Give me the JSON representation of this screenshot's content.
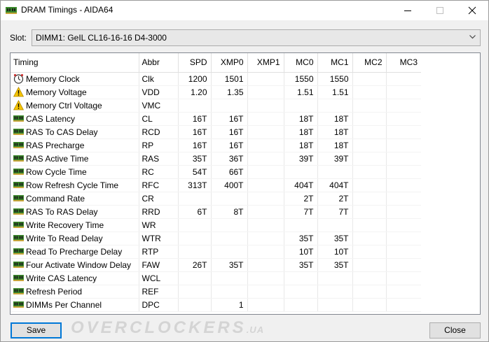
{
  "window": {
    "title": "DRAM Timings - AIDA64"
  },
  "slot": {
    "label": "Slot:",
    "value": "DIMM1: GeIL CL16-16-16 D4-3000"
  },
  "columns": [
    "Timing",
    "Abbr",
    "SPD",
    "XMP0",
    "XMP1",
    "MC0",
    "MC1",
    "MC2",
    "MC3"
  ],
  "rows": [
    {
      "icon": "clock-icon",
      "name": "Memory Clock",
      "abbr": "Clk",
      "spd": "1200",
      "xmp0": "1501",
      "xmp1": "",
      "mc0": "1550",
      "mc1": "1550",
      "mc2": "",
      "mc3": ""
    },
    {
      "icon": "warning-icon",
      "name": "Memory Voltage",
      "abbr": "VDD",
      "spd": "1.20",
      "xmp0": "1.35",
      "xmp1": "",
      "mc0": "1.51",
      "mc1": "1.51",
      "mc2": "",
      "mc3": ""
    },
    {
      "icon": "warning-icon",
      "name": "Memory Ctrl Voltage",
      "abbr": "VMC",
      "spd": "",
      "xmp0": "",
      "xmp1": "",
      "mc0": "",
      "mc1": "",
      "mc2": "",
      "mc3": ""
    },
    {
      "icon": "memory-module-icon",
      "name": "CAS Latency",
      "abbr": "CL",
      "spd": "16T",
      "xmp0": "16T",
      "xmp1": "",
      "mc0": "18T",
      "mc1": "18T",
      "mc2": "",
      "mc3": ""
    },
    {
      "icon": "memory-module-icon",
      "name": "RAS To CAS Delay",
      "abbr": "RCD",
      "spd": "16T",
      "xmp0": "16T",
      "xmp1": "",
      "mc0": "18T",
      "mc1": "18T",
      "mc2": "",
      "mc3": ""
    },
    {
      "icon": "memory-module-icon",
      "name": "RAS Precharge",
      "abbr": "RP",
      "spd": "16T",
      "xmp0": "16T",
      "xmp1": "",
      "mc0": "18T",
      "mc1": "18T",
      "mc2": "",
      "mc3": ""
    },
    {
      "icon": "memory-module-icon",
      "name": "RAS Active Time",
      "abbr": "RAS",
      "spd": "35T",
      "xmp0": "36T",
      "xmp1": "",
      "mc0": "39T",
      "mc1": "39T",
      "mc2": "",
      "mc3": ""
    },
    {
      "icon": "memory-module-icon",
      "name": "Row Cycle Time",
      "abbr": "RC",
      "spd": "54T",
      "xmp0": "66T",
      "xmp1": "",
      "mc0": "",
      "mc1": "",
      "mc2": "",
      "mc3": ""
    },
    {
      "icon": "memory-module-icon",
      "name": "Row Refresh Cycle Time",
      "abbr": "RFC",
      "spd": "313T",
      "xmp0": "400T",
      "xmp1": "",
      "mc0": "404T",
      "mc1": "404T",
      "mc2": "",
      "mc3": ""
    },
    {
      "icon": "memory-module-icon",
      "name": "Command Rate",
      "abbr": "CR",
      "spd": "",
      "xmp0": "",
      "xmp1": "",
      "mc0": "2T",
      "mc1": "2T",
      "mc2": "",
      "mc3": ""
    },
    {
      "icon": "memory-module-icon",
      "name": "RAS To RAS Delay",
      "abbr": "RRD",
      "spd": "6T",
      "xmp0": "8T",
      "xmp1": "",
      "mc0": "7T",
      "mc1": "7T",
      "mc2": "",
      "mc3": ""
    },
    {
      "icon": "memory-module-icon",
      "name": "Write Recovery Time",
      "abbr": "WR",
      "spd": "",
      "xmp0": "",
      "xmp1": "",
      "mc0": "",
      "mc1": "",
      "mc2": "",
      "mc3": ""
    },
    {
      "icon": "memory-module-icon",
      "name": "Write To Read Delay",
      "abbr": "WTR",
      "spd": "",
      "xmp0": "",
      "xmp1": "",
      "mc0": "35T",
      "mc1": "35T",
      "mc2": "",
      "mc3": ""
    },
    {
      "icon": "memory-module-icon",
      "name": "Read To Precharge Delay",
      "abbr": "RTP",
      "spd": "",
      "xmp0": "",
      "xmp1": "",
      "mc0": "10T",
      "mc1": "10T",
      "mc2": "",
      "mc3": ""
    },
    {
      "icon": "memory-module-icon",
      "name": "Four Activate Window Delay",
      "abbr": "FAW",
      "spd": "26T",
      "xmp0": "35T",
      "xmp1": "",
      "mc0": "35T",
      "mc1": "35T",
      "mc2": "",
      "mc3": ""
    },
    {
      "icon": "memory-module-icon",
      "name": "Write CAS Latency",
      "abbr": "WCL",
      "spd": "",
      "xmp0": "",
      "xmp1": "",
      "mc0": "",
      "mc1": "",
      "mc2": "",
      "mc3": ""
    },
    {
      "icon": "memory-module-icon",
      "name": "Refresh Period",
      "abbr": "REF",
      "spd": "",
      "xmp0": "",
      "xmp1": "",
      "mc0": "",
      "mc1": "",
      "mc2": "",
      "mc3": ""
    },
    {
      "icon": "memory-module-icon",
      "name": "DIMMs Per Channel",
      "abbr": "DPC",
      "spd": "",
      "xmp0": "1",
      "xmp1": "",
      "mc0": "",
      "mc1": "",
      "mc2": "",
      "mc3": ""
    }
  ],
  "buttons": {
    "save": "Save",
    "close": "Close"
  },
  "watermark": {
    "main": "OVERCLOCKERS",
    "suffix": ".UA"
  },
  "colors": {
    "accent": "#0078d7",
    "warning": "#f5c400",
    "memory": "#3a8a2a"
  }
}
